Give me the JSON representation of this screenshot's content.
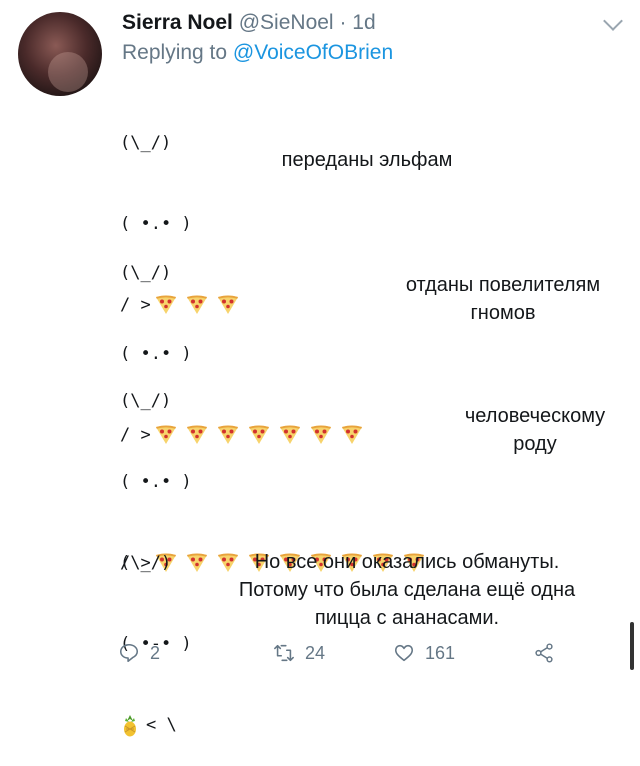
{
  "tweet": {
    "author_name": "Sierra Noel",
    "author_handle": "@SieNoel",
    "separator": "·",
    "time": "1d",
    "reply_prefix": "Replying to",
    "reply_to": "@VoiceOfOBrien"
  },
  "blocks": [
    {
      "ears": "(\\_/)",
      "face": "( •.• )",
      "hand": "/ >",
      "pizza_count": 3,
      "caption": [
        "переданы эльфам"
      ]
    },
    {
      "ears": "(\\_/)",
      "face": "( •.• )",
      "hand": "/ >",
      "pizza_count": 7,
      "caption": [
        "отданы повелителям",
        "гномов"
      ]
    },
    {
      "ears": "(\\_/)",
      "face": "( •.• )",
      "hand": "/ >",
      "pizza_count": 9,
      "caption": [
        "человеческому",
        "роду"
      ]
    },
    {
      "ears": "(\\_/)",
      "face": "( •-• )",
      "hand": "< \\",
      "caption": [
        "Но все они оказались обмануты.",
        "Потому что была сделана ещё одна",
        "пицца с ананасами."
      ]
    }
  ],
  "actions": {
    "replies": "2",
    "retweets": "24",
    "likes": "161"
  },
  "icons": {
    "reply": "speech-bubble-icon",
    "retweet": "retweet-icon",
    "like": "heart-icon",
    "share": "share-icon",
    "menu": "chevron-down-icon"
  },
  "colors": {
    "name": "#14171a",
    "meta": "#657786",
    "mention": "#1b95e0",
    "pizza_crust": "#e8a33d",
    "pizza_cheese": "#f7d36b",
    "pepperoni": "#d2322d"
  }
}
